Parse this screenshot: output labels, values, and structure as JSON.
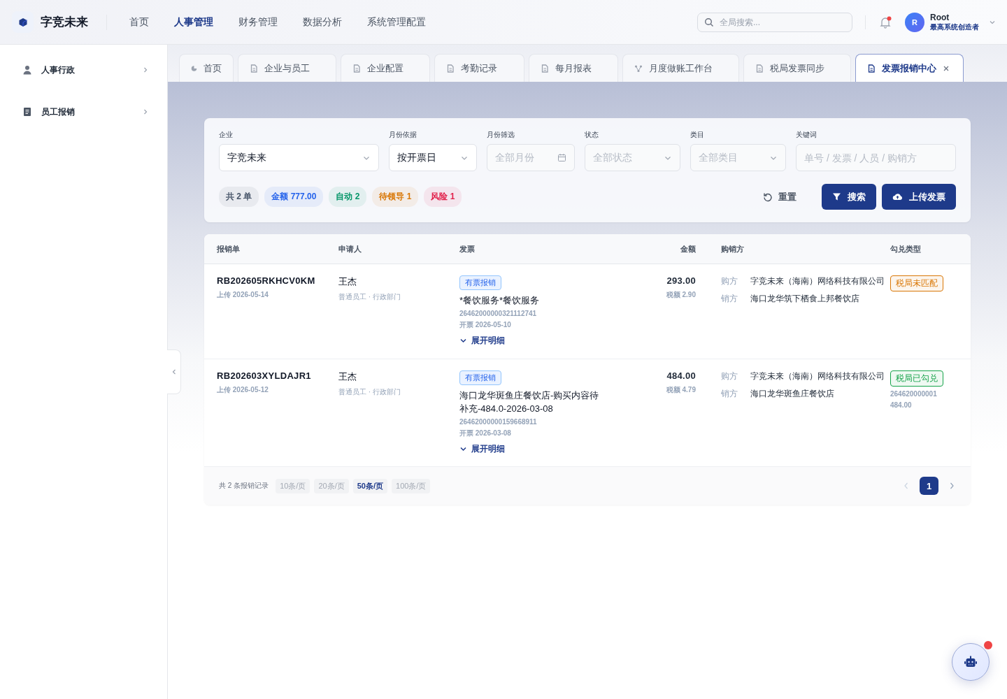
{
  "brand": {
    "name": "字竞未来"
  },
  "nav": [
    {
      "label": "首页",
      "selected": false
    },
    {
      "label": "人事管理",
      "selected": true
    },
    {
      "label": "财务管理",
      "selected": false
    },
    {
      "label": "数据分析",
      "selected": false
    },
    {
      "label": "系统管理配置",
      "selected": false
    }
  ],
  "search": {
    "placeholder": "全局搜索..."
  },
  "notifications": {
    "unread": true
  },
  "user": {
    "avatar": "R",
    "name": "Root",
    "role": "最高系统创造者"
  },
  "sidebar": {
    "items": [
      {
        "label": "人事行政"
      },
      {
        "label": "员工报销"
      }
    ]
  },
  "tabs": [
    {
      "label": "首页",
      "selected": false
    },
    {
      "label": "企业与员工",
      "selected": false
    },
    {
      "label": "企业配置",
      "selected": false
    },
    {
      "label": "考勤记录",
      "selected": false
    },
    {
      "label": "每月报表",
      "selected": false
    },
    {
      "label": "月度做账工作台",
      "selected": false
    },
    {
      "label": "税局发票同步",
      "selected": false
    },
    {
      "label": "发票报销中心",
      "selected": true
    }
  ],
  "filters": [
    {
      "label": "企业",
      "kind": "select",
      "value": "字竞未来"
    },
    {
      "label": "月份依据",
      "kind": "select",
      "value": "按开票日"
    },
    {
      "label": "月份筛选",
      "kind": "date",
      "placeholder": "全部月份"
    },
    {
      "label": "状态",
      "kind": "select",
      "placeholder": "全部状态"
    },
    {
      "label": "类目",
      "kind": "select",
      "placeholder": "全部类目"
    },
    {
      "label": "关键词",
      "kind": "input",
      "placeholder": "单号 / 发票 / 人员 / 购销方"
    }
  ],
  "stats": [
    {
      "text": "共 2 单",
      "color": "#475569"
    },
    {
      "text": "金额 777.00",
      "color": "#2563eb"
    },
    {
      "text": "自动 2",
      "color": "#059669"
    },
    {
      "text": "待领导 1",
      "color": "#d97706"
    },
    {
      "text": "风险 1",
      "color": "#e11d48"
    }
  ],
  "actions": {
    "reset": "重置",
    "search": "搜索",
    "upload": "上传发票"
  },
  "table": {
    "columns": [
      "报销单",
      "申请人",
      "发票",
      "金额",
      "购销方",
      "勾兑类型"
    ],
    "rows": [
      {
        "id": "RB202605RKHCV0KM",
        "uploaded": "上传 2026-05-14",
        "applicant": "王杰",
        "role": "普通员工 · 行政部门",
        "tag": "有票报销",
        "title": "*餐饮服务*餐饮服务",
        "invoice_no": "26462000000321112741",
        "issued": "开票 2026-05-10",
        "expand": "展开明细",
        "amount": "293.00",
        "tax": "税额 2.90",
        "buyer_label": "购方",
        "buyer": "字竞未来（海南）网络科技有限公司",
        "seller_label": "销方",
        "seller": "海口龙华筑下栖食上邦餐饮店",
        "match": {
          "label": "税局未匹配",
          "color": "#d97706"
        },
        "match_lines": []
      },
      {
        "id": "RB202603XYLDAJR1",
        "uploaded": "上传 2026-05-12",
        "applicant": "王杰",
        "role": "普通员工 · 行政部门",
        "tag": "有票报销",
        "title": "海口龙华斑鱼庄餐饮店-购买内容待补充-484.0-2026-03-08",
        "invoice_no": "26462000000159668911",
        "issued": "开票 2026-03-08",
        "expand": "展开明细",
        "amount": "484.00",
        "tax": "税额 4.79",
        "buyer_label": "购方",
        "buyer": "字竞未来（海南）网络科技有限公司",
        "seller_label": "销方",
        "seller": "海口龙华斑鱼庄餐饮店",
        "match": {
          "label": "税局已勾兑",
          "color": "#16a34a"
        },
        "match_lines": [
          "264620000001",
          "484.00"
        ]
      }
    ]
  },
  "pagination": {
    "total": "共 2 条报销记录",
    "sizes": [
      {
        "label": "10条/页",
        "selected": false
      },
      {
        "label": "20条/页",
        "selected": false
      },
      {
        "label": "50条/页",
        "selected": true
      },
      {
        "label": "100条/页",
        "selected": false
      }
    ],
    "pages": [
      {
        "label": "1",
        "selected": true
      }
    ]
  },
  "assistant": {
    "unread": true
  }
}
